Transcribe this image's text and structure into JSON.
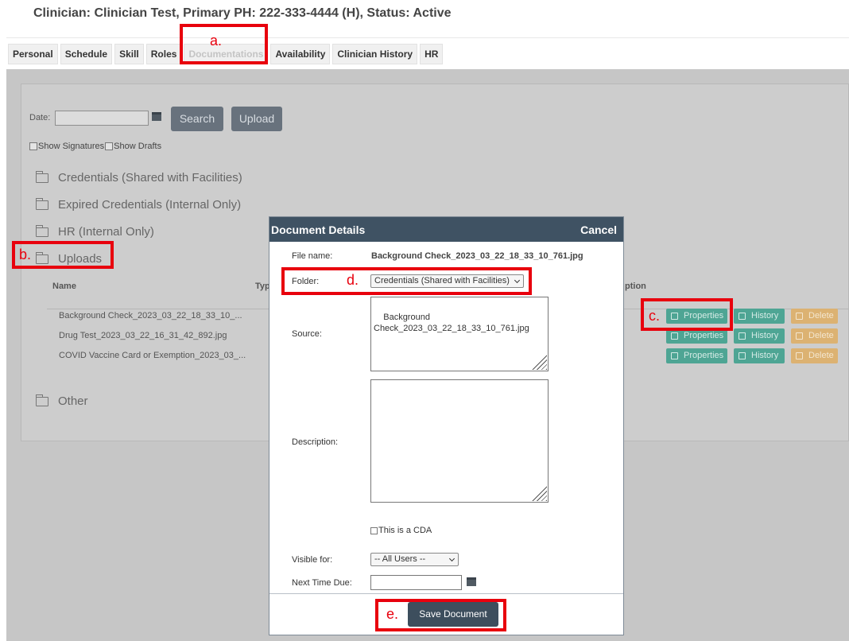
{
  "header": {
    "title": "Clinician: Clinician Test, Primary PH: 222-333-4444 (H), Status: Active"
  },
  "tabs": [
    "Personal",
    "Schedule",
    "Skill",
    "Roles",
    "Documentations",
    "Availability",
    "Clinician History",
    "HR"
  ],
  "filters": {
    "date_label": "Date:",
    "date_value": "",
    "search_label": "Search",
    "upload_label": "Upload",
    "show_signatures": "Show Signatures",
    "show_drafts": "Show Drafts"
  },
  "folders": [
    "Credentials (Shared with Facilities)",
    "Expired Credentials (Internal Only)",
    "HR (Internal Only)",
    "Uploads",
    "Other"
  ],
  "table": {
    "headers": {
      "name": "Name",
      "type": "Typ",
      "description": "ption"
    },
    "rows": [
      "Background Check_2023_03_22_18_33_10_...",
      "Drug Test_2023_03_22_16_31_42_892.jpg",
      "COVID Vaccine Card or Exemption_2023_03_..."
    ],
    "actions": {
      "properties": "Properties",
      "history": "History",
      "delete": "Delete"
    }
  },
  "modal": {
    "title": "Document Details",
    "cancel": "Cancel",
    "file_name_label": "File name:",
    "file_name": "Background Check_2023_03_22_18_33_10_761.jpg",
    "folder_label": "Folder:",
    "folder_value": "Credentials (Shared with Facilities)",
    "source_label": "Source:",
    "source_value": "Background\nCheck_2023_03_22_18_33_10_761.jpg",
    "description_label": "Description:",
    "description_value": "",
    "cda_label": "This is a CDA",
    "visible_label": "Visible for:",
    "visible_value": "-- All Users --",
    "next_due_label": "Next Time Due:",
    "save_label": "Save Document"
  },
  "annotations": {
    "a": "a.",
    "b": "b.",
    "c": "c.",
    "d": "d.",
    "e": "e."
  },
  "colors": {
    "modal_header": "#3f5263",
    "action_green": "#4ea594",
    "action_orange": "#dcb272",
    "annotation_red": "#e8000d"
  }
}
